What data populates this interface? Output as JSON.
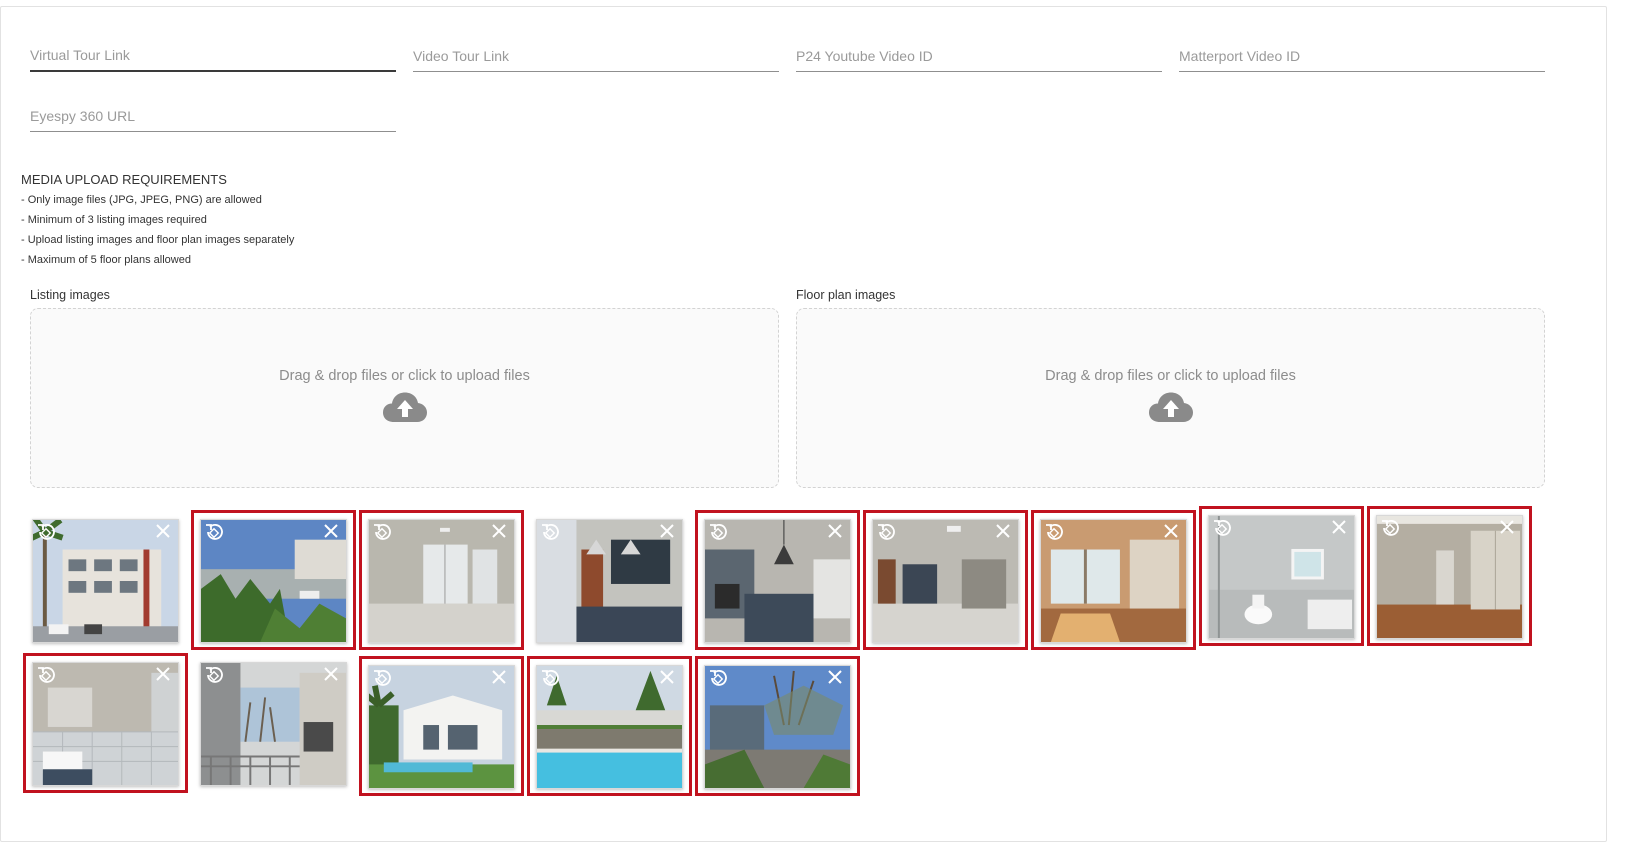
{
  "fields": {
    "virtual_tour": {
      "placeholder": "Virtual Tour Link",
      "value": ""
    },
    "video_tour": {
      "placeholder": "Video Tour Link",
      "value": ""
    },
    "p24_youtube": {
      "placeholder": "P24 Youtube Video ID",
      "value": ""
    },
    "matterport": {
      "placeholder": "Matterport Video ID",
      "value": ""
    },
    "eyespy": {
      "placeholder": "Eyespy 360 URL",
      "value": ""
    }
  },
  "requirements": {
    "title": "MEDIA UPLOAD REQUIREMENTS",
    "items": [
      "- Only image files (JPG, JPEG, PNG) are allowed",
      "- Minimum of 3 listing images required",
      "- Upload listing images and floor plan images separately",
      "- Maximum of 5 floor plans allowed"
    ]
  },
  "listing": {
    "label": "Listing images",
    "dropzone_text": "Drag & drop files or click to upload files"
  },
  "floorplan": {
    "label": "Floor plan images",
    "dropzone_text": "Drag & drop files or click to upload files"
  },
  "icons": {
    "upload": "cloud-upload-icon",
    "rotate": "rotate-icon",
    "remove": "close-icon"
  },
  "colors": {
    "highlight_border": "#c1121f",
    "dropzone_bg": "#fafafa",
    "placeholder_text": "#9a9a9a"
  },
  "thumbnails": [
    {
      "scene": "apartment-building-exterior",
      "highlighted": false
    },
    {
      "scene": "garden-street-view",
      "highlighted": true
    },
    {
      "scene": "empty-living-room",
      "highlighted": true
    },
    {
      "scene": "kitchen-with-pendant-lights",
      "highlighted": false
    },
    {
      "scene": "kitchen-island",
      "highlighted": true
    },
    {
      "scene": "open-plan-living",
      "highlighted": true
    },
    {
      "scene": "bedroom-with-sunlight",
      "highlighted": true
    },
    {
      "scene": "bathroom-with-window",
      "highlighted": true
    },
    {
      "scene": "bedroom-wooden-floor",
      "highlighted": true
    },
    {
      "scene": "bathroom-basin",
      "highlighted": true
    },
    {
      "scene": "balcony-braai",
      "highlighted": false
    },
    {
      "scene": "house-with-pool",
      "highlighted": true
    },
    {
      "scene": "swimming-pool",
      "highlighted": true
    },
    {
      "scene": "parking-area-trees",
      "highlighted": true
    }
  ]
}
